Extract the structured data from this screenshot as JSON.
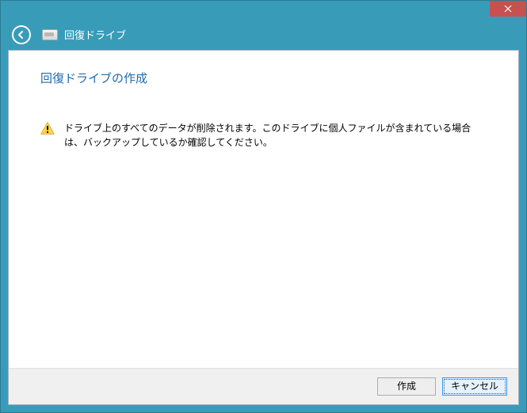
{
  "header": {
    "app_title": "回復ドライブ"
  },
  "content": {
    "heading": "回復ドライブの作成",
    "warning_text": "ドライブ上のすべてのデータが削除されます。このドライブに個人ファイルが含まれている場合は、バックアップしているか確認してください。"
  },
  "footer": {
    "create_label": "作成",
    "cancel_label": "キャンセル"
  }
}
